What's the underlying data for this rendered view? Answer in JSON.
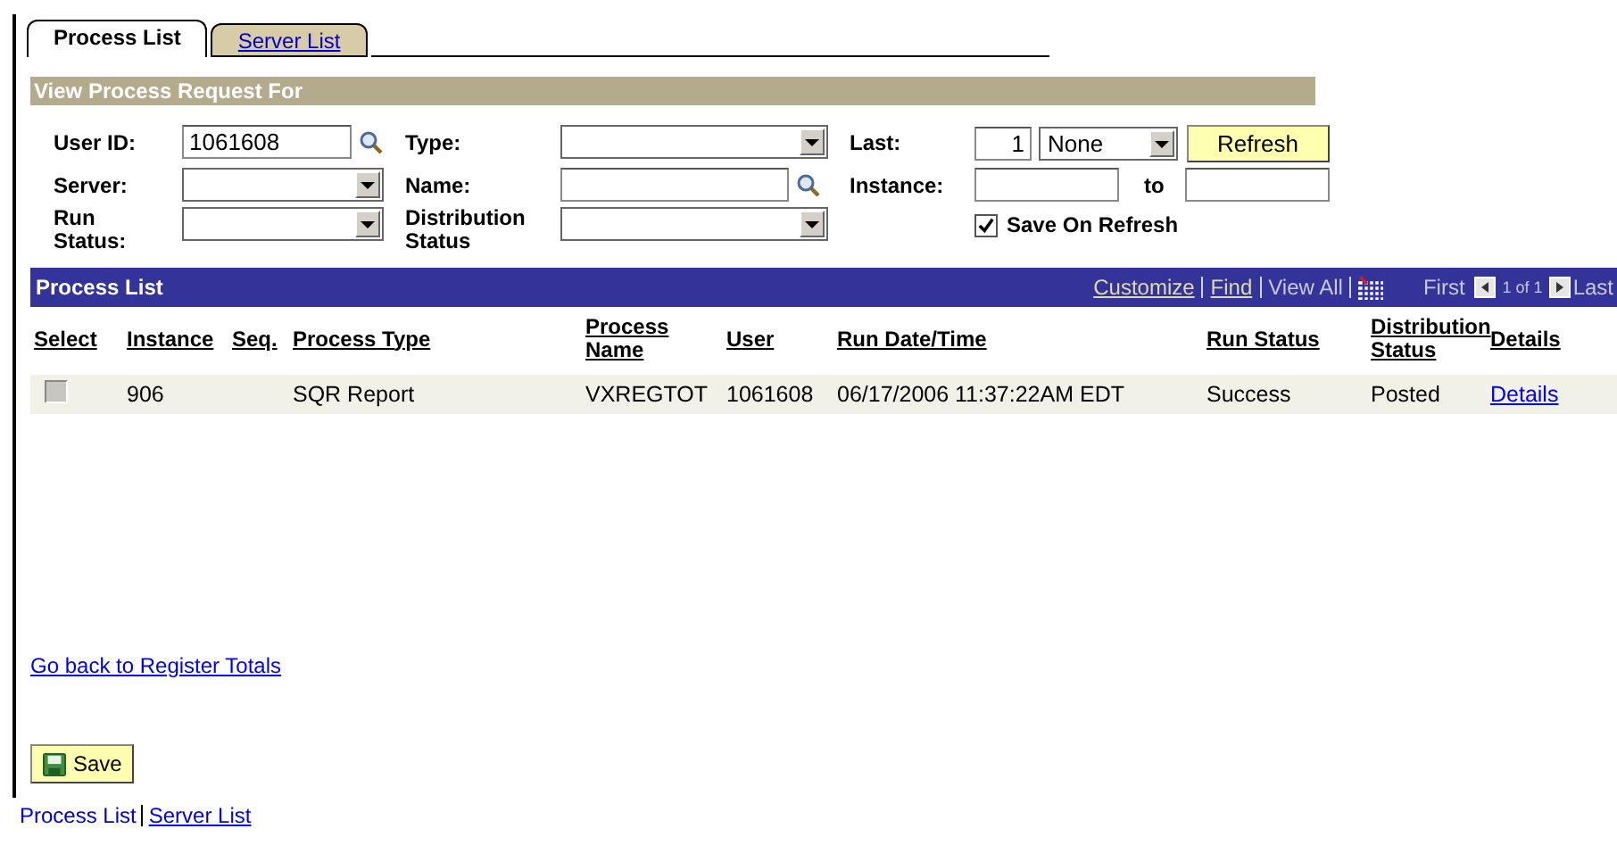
{
  "tabs": [
    {
      "label": "Process List",
      "selected": true
    },
    {
      "label": "Server List",
      "selected": false
    }
  ],
  "filter": {
    "title": "View Process Request For",
    "user_id": {
      "label": "User ID:",
      "value": "1061608"
    },
    "type": {
      "label": "Type:"
    },
    "last": {
      "label": "Last:",
      "value": "1",
      "unit": "None"
    },
    "refresh_button": "Refresh",
    "server": {
      "label": "Server:"
    },
    "name": {
      "label": "Name:"
    },
    "instance": {
      "label": "Instance:",
      "to_label": "to"
    },
    "run_status": {
      "label": "Run Status:"
    },
    "distribution_status": {
      "label": "Distribution Status"
    },
    "save_on_refresh": {
      "label": "Save On Refresh",
      "checked": true
    }
  },
  "process_list": {
    "title": "Process List",
    "customize": "Customize",
    "find": "Find",
    "view_all": "View All",
    "first": "First",
    "page": "1 of 1",
    "last": "Last",
    "columns": [
      "Select",
      "Instance",
      "Seq.",
      "Process Type",
      "Process Name",
      "User",
      "Run Date/Time",
      "Run Status",
      "Distribution Status",
      "Details"
    ],
    "rows": [
      {
        "selected": false,
        "instance": "906",
        "seq": "",
        "process_type": "SQR Report",
        "process_name": "VXREGTOT",
        "user": "1061608",
        "run_date_time": "06/17/2006 11:37:22AM EDT",
        "run_status": "Success",
        "distribution_status": "Posted",
        "details": "Details"
      }
    ]
  },
  "back_link": "Go back to Register Totals",
  "save_button": "Save",
  "footer_links": [
    {
      "label": "Process List",
      "link": false
    },
    {
      "label": "Server List",
      "link": true
    }
  ]
}
